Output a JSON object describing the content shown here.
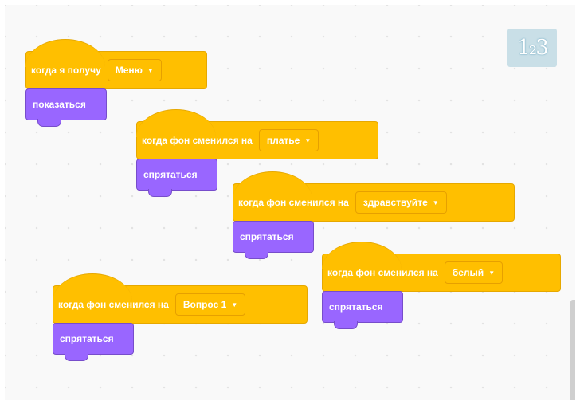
{
  "workspace": {
    "language_badge": "1₂3"
  },
  "scripts": [
    {
      "hat_text": "когда я получу",
      "dropdown": "Меню",
      "action": "показаться"
    },
    {
      "hat_text": "когда фон сменился на",
      "dropdown": "платье",
      "action": "спрятаться"
    },
    {
      "hat_text": "когда фон сменился на",
      "dropdown": "здравствуйте",
      "action": "спрятаться"
    },
    {
      "hat_text": "когда фон сменился на",
      "dropdown": "белый",
      "action": "спрятаться"
    },
    {
      "hat_text": "когда фон сменился на",
      "dropdown": "Вопрос 1",
      "action": "спрятаться"
    }
  ],
  "colors": {
    "event_block": "#ffbf00",
    "looks_block": "#9966ff",
    "workspace_bg": "#f9f9f9"
  },
  "icons": {
    "dropdown": "caret-down-icon"
  }
}
